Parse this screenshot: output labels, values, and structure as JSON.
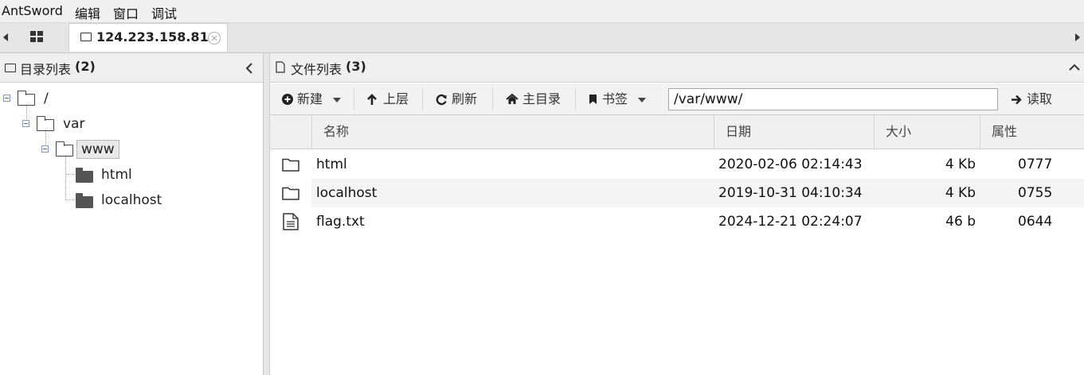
{
  "menubar": {
    "app": "AntSword",
    "edit": "编辑",
    "window": "窗口",
    "debug": "调试"
  },
  "tabs": {
    "connection_label": "124.223.158.81"
  },
  "dir_panel": {
    "title": "目录列表",
    "count": "(2)",
    "tree": {
      "root": "/",
      "var": "var",
      "www": "www",
      "html": "html",
      "localhost": "localhost"
    }
  },
  "file_panel": {
    "title": "文件列表",
    "count": "(3)",
    "toolbar": {
      "new": "新建",
      "up": "上层",
      "refresh": "刷新",
      "home": "主目录",
      "bookmark": "书签",
      "path": "/var/www/",
      "read": "读取"
    },
    "columns": {
      "name": "名称",
      "date": "日期",
      "size": "大小",
      "attr": "属性"
    },
    "files": [
      {
        "icon": "folder-icon",
        "name": "html",
        "date": "2020-02-06 02:14:43",
        "size": "4 Kb",
        "attr": "0777"
      },
      {
        "icon": "folder-icon",
        "name": "localhost",
        "date": "2019-10-31 04:10:34",
        "size": "4 Kb",
        "attr": "0755"
      },
      {
        "icon": "file-text-icon",
        "name": "flag.txt",
        "date": "2024-12-21 02:24:07",
        "size": "46 b",
        "attr": "0644"
      }
    ]
  }
}
